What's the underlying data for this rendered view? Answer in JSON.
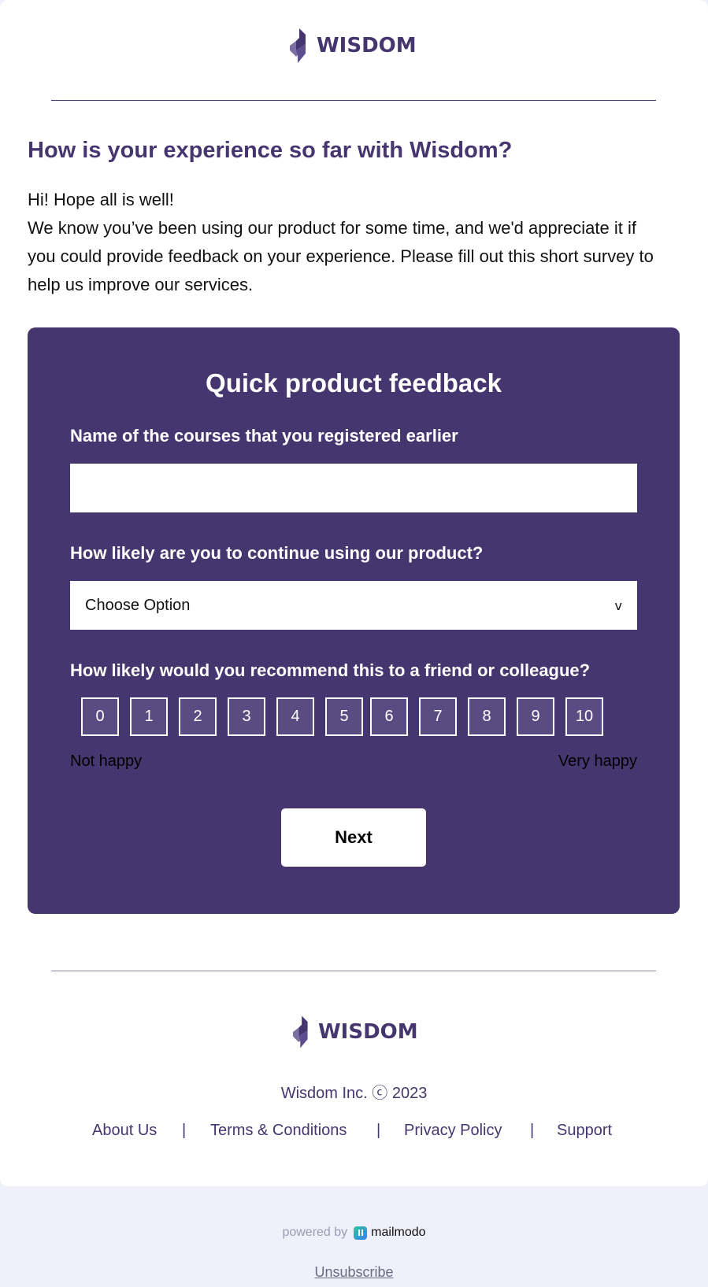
{
  "brand": {
    "name": "WISDOM",
    "color": "#45366f"
  },
  "email": {
    "heading": "How is your experience so far with Wisdom?",
    "greeting": "Hi! Hope all is well!",
    "body": "We know you’ve been using our product for some time, and we'd appreciate it if you could provide feedback on your experience. Please fill out this short survey to help us improve our services."
  },
  "survey": {
    "title": "Quick product feedback",
    "question_courses": {
      "label": "Name of the courses that you registered earlier",
      "value": ""
    },
    "question_continue": {
      "label": "How likely are you to continue using our product?",
      "selected": "Choose Option",
      "caret": "v"
    },
    "question_recommend": {
      "label": "How likely would you recommend this to a friend or colleague?",
      "scale": [
        "0",
        "1",
        "2",
        "3",
        "4",
        "5",
        "6",
        "7",
        "8",
        "9",
        "10"
      ],
      "low_label": "Not happy",
      "high_label": "Very happy"
    },
    "next_label": "Next"
  },
  "footer": {
    "copyright": "Wisdom Inc. ⓒ 2023",
    "links": [
      "About Us",
      "Terms & Conditions",
      "Privacy Policy",
      "Support"
    ],
    "separator": "|"
  },
  "powered_by": {
    "text": "powered by",
    "provider": "mailmodo"
  },
  "unsubscribe_label": "Unsubscribe"
}
